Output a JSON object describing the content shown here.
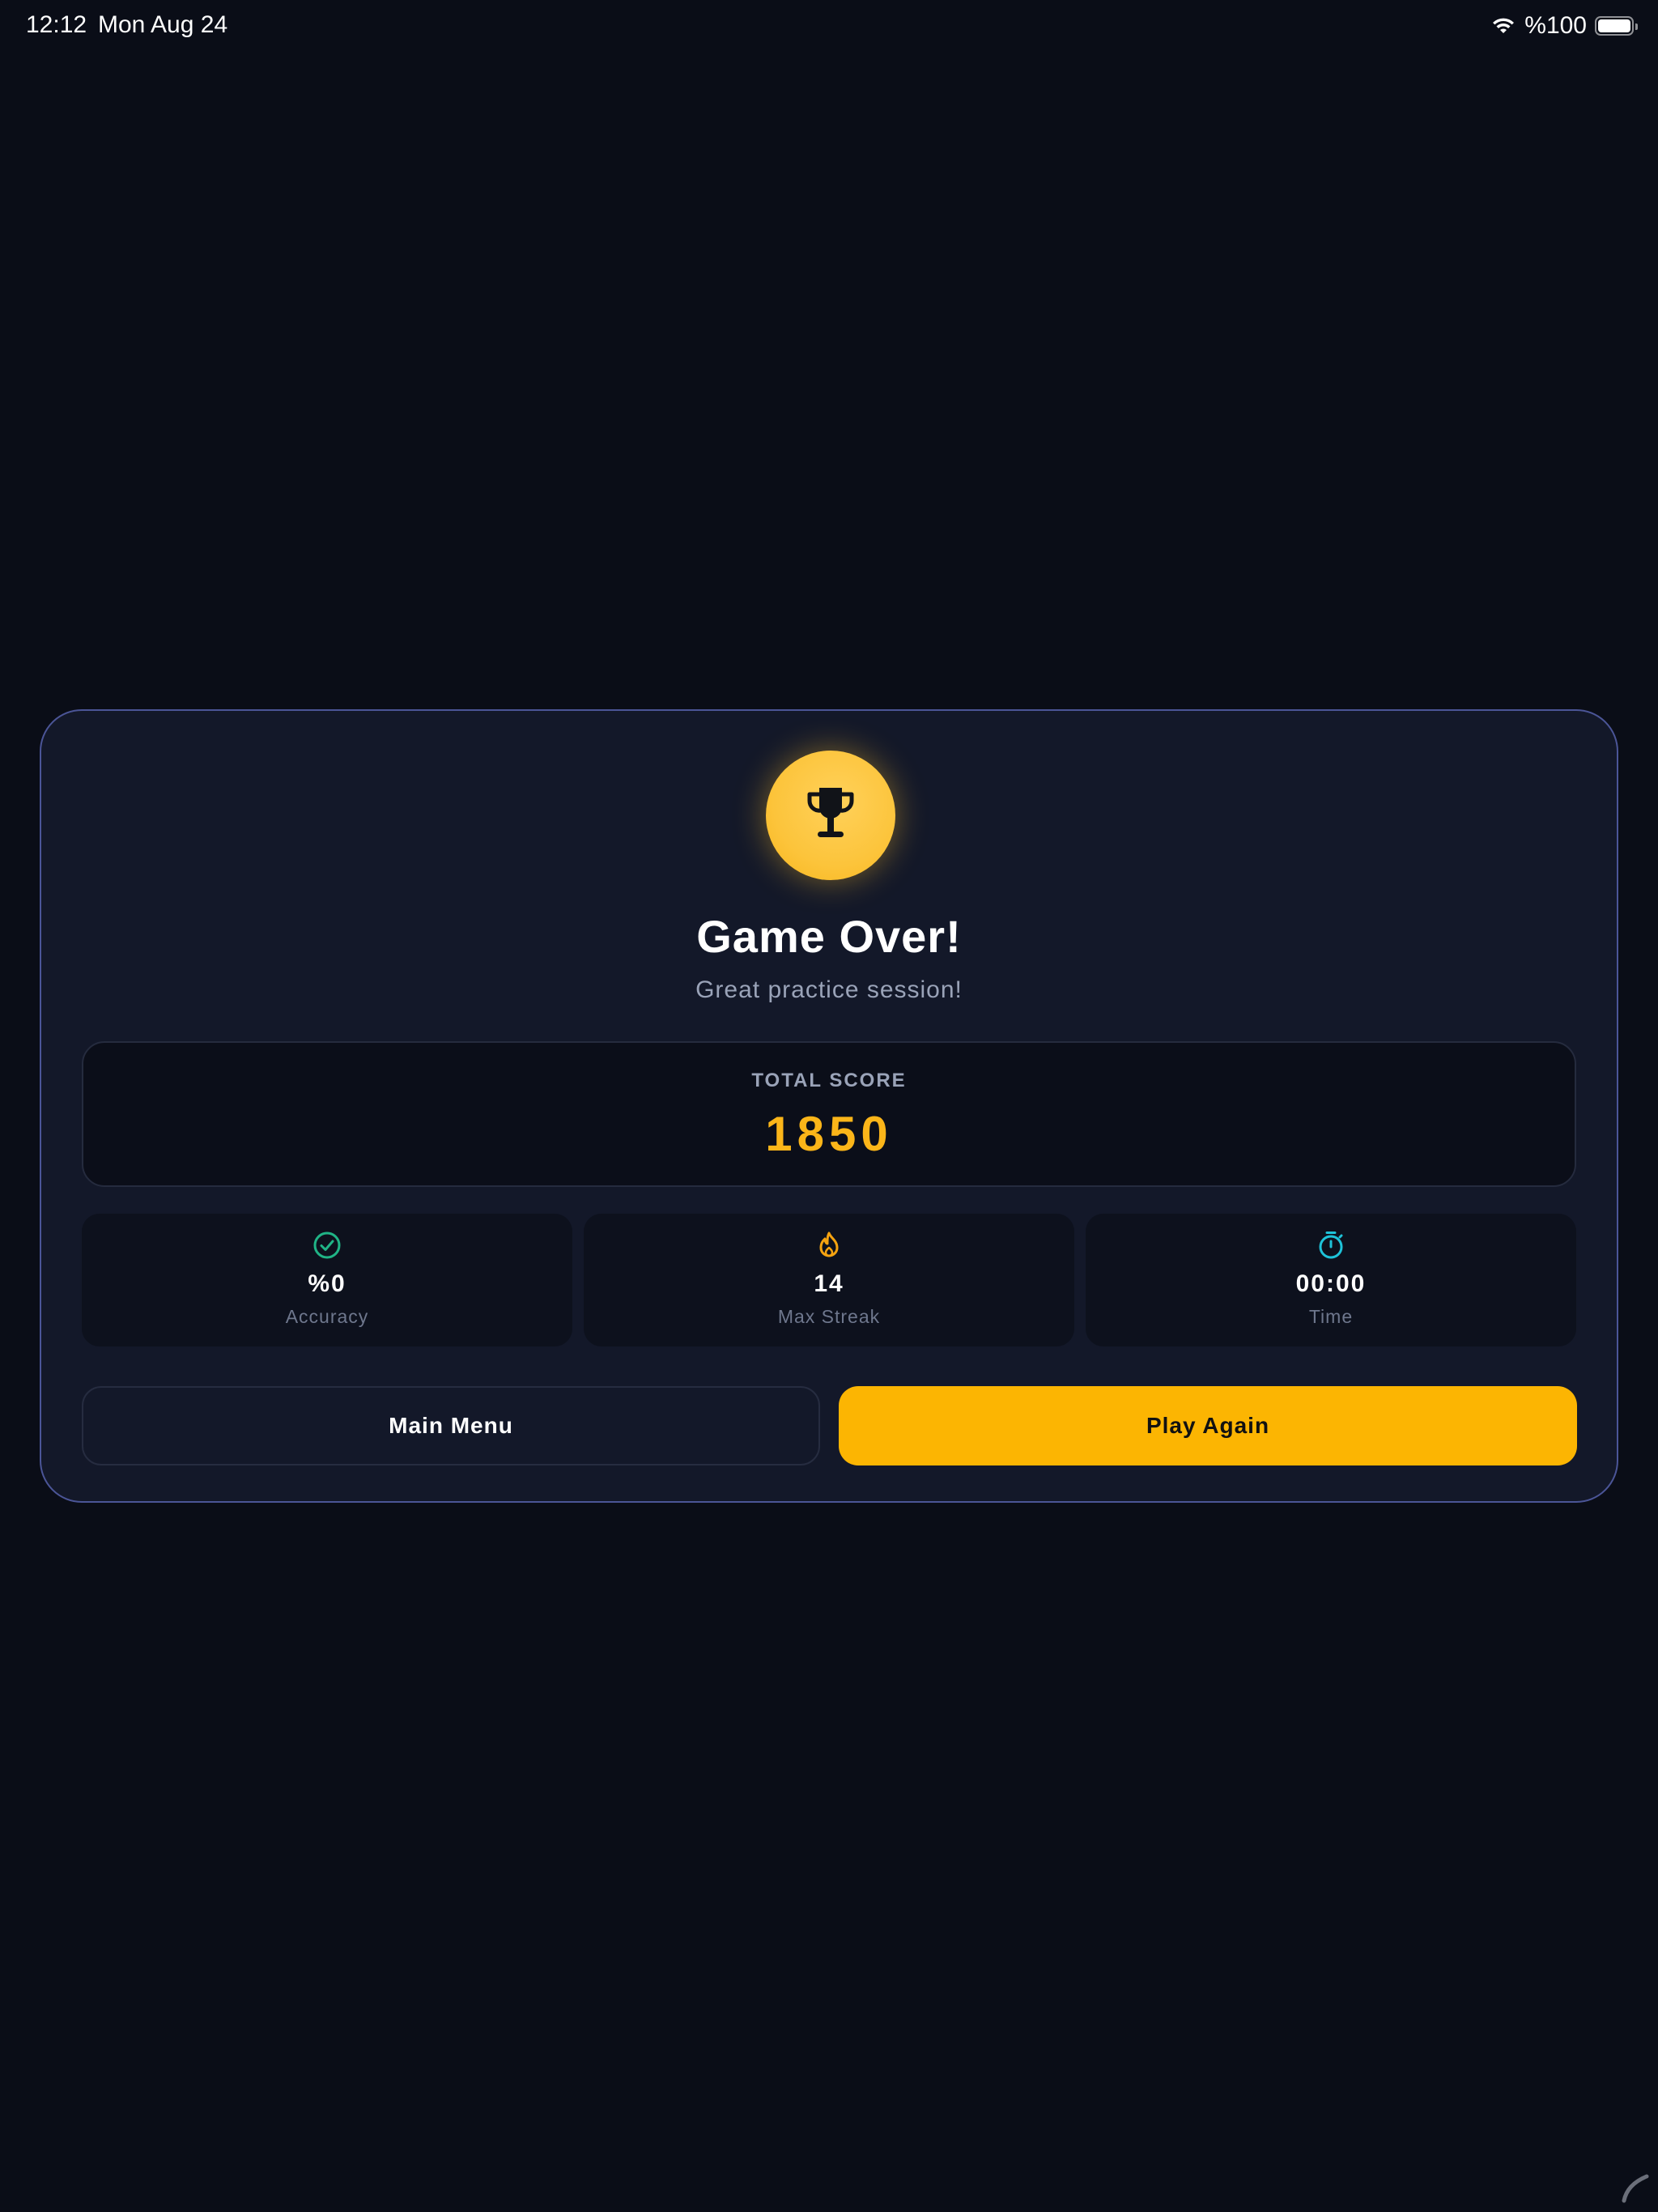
{
  "status_bar": {
    "time": "12:12",
    "date": "Mon Aug 24",
    "battery": "%100",
    "icons": [
      "wifi-icon",
      "battery-icon"
    ]
  },
  "result": {
    "title": "Game Over!",
    "subtitle": "Great practice session!",
    "trophy_icon": "trophy-icon",
    "total_score_label": "TOTAL SCORE",
    "total_score": "1850"
  },
  "stats": [
    {
      "icon": "check-circle-icon",
      "value": "%0",
      "label": "Accuracy",
      "color": "#20b486"
    },
    {
      "icon": "flame-icon",
      "value": "14",
      "label": "Max Streak",
      "color": "#f5a310"
    },
    {
      "icon": "stopwatch-icon",
      "value": "00:00",
      "label": "Time",
      "color": "#1ec3d9"
    }
  ],
  "buttons": {
    "main_menu": "Main Menu",
    "play_again": "Play Again"
  },
  "colors": {
    "background": "#0a0d17",
    "card": "#131829",
    "card_border": "#4b5597",
    "accent": "#fcb502",
    "score": "#fbb519"
  }
}
